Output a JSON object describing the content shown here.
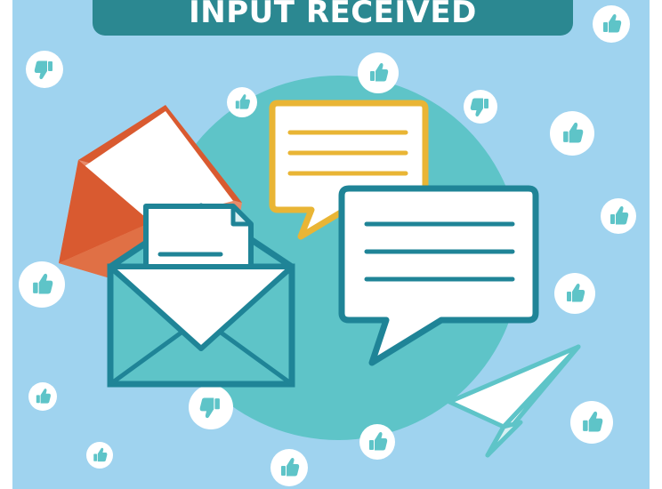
{
  "banner": {
    "title": "INPUT RECEIVED"
  },
  "colors": {
    "background": "#9fd3ef",
    "circle": "#5ec4c8",
    "banner": "#2b8891",
    "teal": "#1f8497",
    "red_envelope": "#d95a30",
    "yellow_bubble": "#e9b535",
    "white": "#ffffff"
  },
  "icons": [
    "thumbs-up-icon",
    "thumbs-down-icon",
    "envelope-icon",
    "letter-icon",
    "speech-bubble-icon",
    "paper-plane-icon"
  ]
}
